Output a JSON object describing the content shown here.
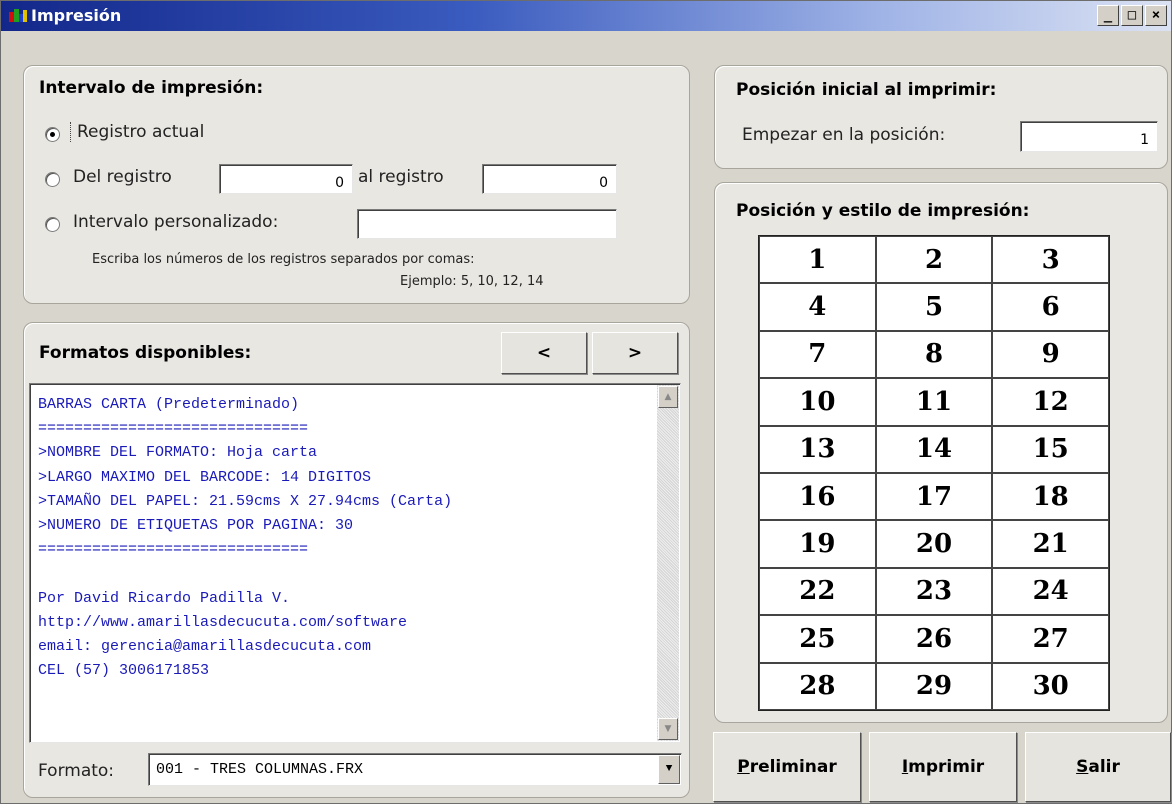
{
  "window": {
    "title": "Impresión",
    "controls": [
      "_",
      "□",
      "×"
    ]
  },
  "interval": {
    "title": "Intervalo de impresión:",
    "current_record_label": "Registro actual",
    "from_label": "Del registro",
    "from_value": "0",
    "to_label": "al registro",
    "to_value": "0",
    "custom_label": "Intervalo personalizado:",
    "custom_value": "",
    "help_line1": "Escriba los números de los registros separados por comas:",
    "help_line2": "Ejemplo: 5, 10, 12, 14",
    "selected": "current"
  },
  "formats": {
    "title": "Formatos disponibles:",
    "prev_label": "<",
    "next_label": ">",
    "lines": [
      "BARRAS CARTA (Predeterminado)",
      "==============================",
      ">NOMBRE DEL FORMATO: Hoja carta",
      ">LARGO MAXIMO DEL BARCODE: 14 DIGITOS",
      ">TAMAÑO DEL PAPEL: 21.59cms X 27.94cms (Carta)",
      ">NUMERO DE ETIQUETAS POR PAGINA: 30",
      "==============================",
      "",
      "Por David Ricardo Padilla V.",
      "http://www.amarillasdecucuta.com/software",
      "email: gerencia@amarillasdecucuta.com",
      "CEL (57) 3006171853"
    ],
    "format_label": "Formato:",
    "format_value": "001 - TRES COLUMNAS.FRX"
  },
  "start_position": {
    "title": "Posición inicial al imprimir:",
    "label": "Empezar en la posición:",
    "value": "1"
  },
  "position_style": {
    "title": "Posición y estilo de impresión:",
    "cells": [
      "1",
      "2",
      "3",
      "4",
      "5",
      "6",
      "7",
      "8",
      "9",
      "10",
      "11",
      "12",
      "13",
      "14",
      "15",
      "16",
      "17",
      "18",
      "19",
      "20",
      "21",
      "22",
      "23",
      "24",
      "25",
      "26",
      "27",
      "28",
      "29",
      "30"
    ]
  },
  "buttons": {
    "preview_first": "P",
    "preview_rest": "reliminar",
    "print_first": "I",
    "print_rest": "mprimir",
    "exit_first": "S",
    "exit_rest": "alir"
  },
  "colors": {
    "list_text": "#1a1ab8",
    "title_bar_start": "#13278a",
    "window_bg": "#d8d5cc"
  }
}
